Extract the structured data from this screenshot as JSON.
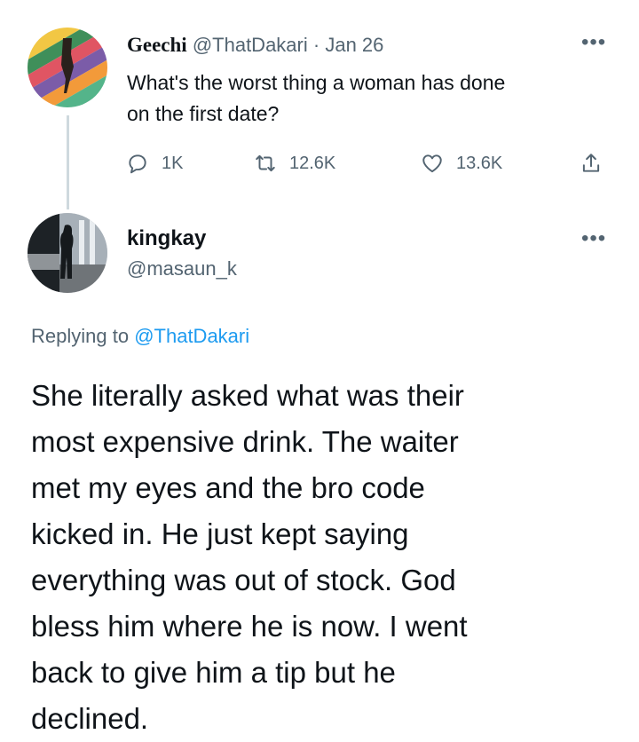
{
  "tweet": {
    "author_name": "Geechi",
    "author_handle": "@ThatDakari",
    "date": "· Jan 26",
    "text_lines": [
      "What's the worst thing a woman has done",
      "on the first date?"
    ],
    "stats": {
      "replies": "1K",
      "retweets": "12.6K",
      "likes": "13.6K"
    },
    "more_label": "•••"
  },
  "reply": {
    "author_name": "kingkay",
    "author_handle": "@masaun_k",
    "more_label": "•••",
    "replying_prefix": "Replying to",
    "replying_mention": "@ThatDakari",
    "text_lines": [
      "She literally asked what was their",
      "most expensive drink. The waiter",
      "met my eyes and the bro code",
      "kicked in. He just kept saying",
      "everything was out of stock. God",
      "bless him where he is now. I went",
      "back to give him a tip but he",
      "declined."
    ]
  },
  "icons": [
    "reply-icon",
    "retweet-icon",
    "like-icon",
    "share-icon",
    "more-icon"
  ],
  "colors": {
    "text": "#0f1419",
    "secondary": "#536471",
    "mention": "#1d9bf0",
    "thread_line": "#cfd9de"
  }
}
